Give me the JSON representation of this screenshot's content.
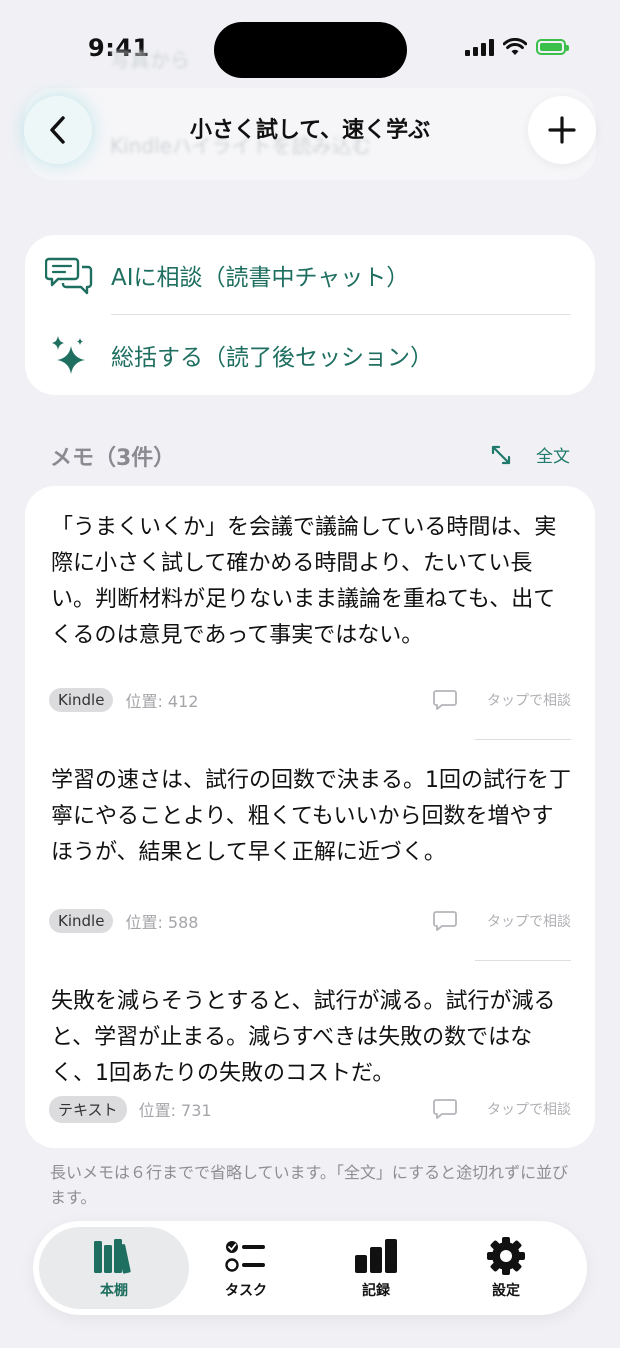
{
  "status": {
    "time": "9:41"
  },
  "nav": {
    "title": "小さく試して、速く学ぶ"
  },
  "ghost": {
    "line1": "写真から",
    "line2": "Kindleハイライトを読み込む"
  },
  "ai": {
    "chat_label": "AIに相談（読書中チャット）",
    "summary_label": "総括する（読了後セッション）"
  },
  "memos": {
    "header": "メモ（3件）",
    "fulltext_label": "全文",
    "items": [
      {
        "text": "「うまくいくか」を会議で議論している時間は、実際に小さく試して確かめる時間より、たいてい長い。判断材料が足りないまま議論を重ねても、出てくるのは意見であって事実ではない。",
        "source": "Kindle",
        "position": "位置: 412",
        "consult": "タップで相談"
      },
      {
        "text": "学習の速さは、試行の回数で決まる。1回の試行を丁寧にやることより、粗くてもいいから回数を増やすほうが、結果として早く正解に近づく。",
        "source": "Kindle",
        "position": "位置: 588",
        "consult": "タップで相談"
      },
      {
        "text": "失敗を減らそうとすると、試行が減る。試行が減ると、学習が止まる。減らすべきは失敗の数ではなく、1回あたりの失敗のコストだ。",
        "source": "テキスト",
        "position": "位置: 731",
        "consult": "タップで相談"
      }
    ],
    "note": "長いメモは６行までで省略しています。「全文」にすると途切れずに並びます。"
  },
  "tabs": [
    {
      "label": "本棚",
      "icon": "books-icon",
      "active": true
    },
    {
      "label": "タスク",
      "icon": "checklist-icon",
      "active": false
    },
    {
      "label": "記録",
      "icon": "bar-chart-icon",
      "active": false
    },
    {
      "label": "設定",
      "icon": "gear-icon",
      "active": false
    }
  ],
  "colors": {
    "accent": "#1f6f61",
    "background": "#f1f1f5",
    "battery": "#3bbf4b"
  }
}
